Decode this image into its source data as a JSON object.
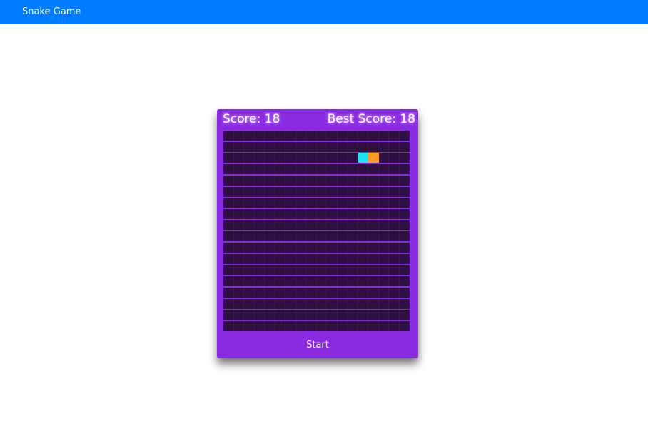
{
  "header": {
    "title": "Snake Game"
  },
  "game": {
    "score_label": "Score: 18",
    "best_score_label": "Best Score: 18",
    "score": 18,
    "best_score": 18,
    "start_label": "Start",
    "grid": {
      "rows": 18,
      "cols": 18
    },
    "snake": [
      {
        "row": 2,
        "col": 13,
        "part": "head"
      },
      {
        "row": 2,
        "col": 14,
        "part": "body"
      }
    ],
    "colors": {
      "header": "#007bff",
      "card": "#8a2be2",
      "cell": "#2e1040",
      "snake_head": "#1fe3f5",
      "snake_body": "#ff9a26"
    }
  }
}
